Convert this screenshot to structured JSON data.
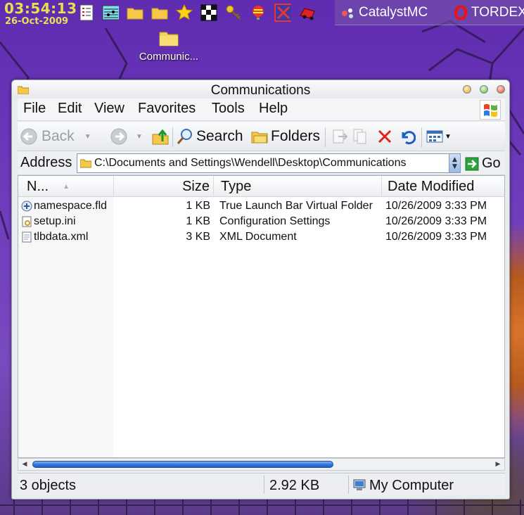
{
  "clock": {
    "time": "03:54:13",
    "date": "26-Oct-2009"
  },
  "launch_icons": [
    "checklist-icon",
    "music-score-icon",
    "folder-icon",
    "folder-icon",
    "star-icon",
    "checker-puzzle-icon",
    "keys-icon",
    "balloon-icon",
    "red-x-tool-icon",
    "red-car-icon"
  ],
  "taskbar": {
    "items": [
      {
        "label": "CatalystMC",
        "icon": "catalyst-icon"
      },
      {
        "label": "TORDEX",
        "icon": "opera-icon"
      }
    ]
  },
  "desktop_icon": {
    "label": "Communic..."
  },
  "window": {
    "title": "Communications",
    "menu": [
      "File",
      "Edit",
      "View",
      "Favorites",
      "Tools",
      "Help"
    ],
    "toolbar": {
      "back": "Back",
      "search": "Search",
      "folders": "Folders"
    },
    "address": {
      "label": "Address",
      "path": "C:\\Documents and Settings\\Wendell\\Desktop\\Communications",
      "go": "Go"
    },
    "columns": {
      "name": "N...",
      "size": "Size",
      "type": "Type",
      "modified": "Date Modified"
    },
    "files": [
      {
        "name": "namespace.fld",
        "size": "1 KB",
        "type": "True Launch Bar Virtual Folder",
        "modified": "10/26/2009 3:33 PM",
        "icon": "virtual-folder-icon"
      },
      {
        "name": "setup.ini",
        "size": "1 KB",
        "type": "Configuration Settings",
        "modified": "10/26/2009 3:33 PM",
        "icon": "ini-file-icon"
      },
      {
        "name": "tlbdata.xml",
        "size": "3 KB",
        "type": "XML Document",
        "modified": "10/26/2009 3:33 PM",
        "icon": "xml-file-icon"
      }
    ],
    "status": {
      "objects": "3 objects",
      "size": "2.92 KB",
      "location": "My Computer"
    }
  },
  "colors": {
    "clock": "#e8e04a",
    "desktop": "#6a38b8",
    "scroll_thumb": "#2f76d8"
  }
}
